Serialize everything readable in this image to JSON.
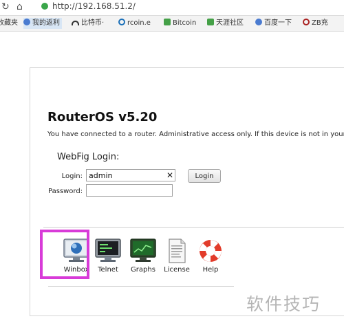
{
  "browser": {
    "url": "http://192.168.51.2/",
    "bookmarks": [
      {
        "label": "收藏夹",
        "icon": "folder-icon",
        "color": "#c9a13b"
      },
      {
        "label": "我的返利",
        "icon": "paw-icon",
        "color": "#4a7bd0"
      },
      {
        "label": "比特币·",
        "icon": "arc-icon",
        "color": "#333333"
      },
      {
        "label": "rcoin.e",
        "icon": "ring-icon",
        "color": "#1a6fb8"
      },
      {
        "label": "Bitcoin",
        "icon": "leaf-icon",
        "color": "#44a047"
      },
      {
        "label": "天涯社区",
        "icon": "leaf-icon",
        "color": "#44a047"
      },
      {
        "label": "百度一下",
        "icon": "paw-icon",
        "color": "#4a7bd0"
      },
      {
        "label": "ZB充",
        "icon": "ring-icon",
        "color": "#aa2222"
      }
    ]
  },
  "page": {
    "title": "RouterOS v5.20",
    "notice": "You have connected to a router. Administrative access only. If this device is not in your possession",
    "login_heading": "WebFig Login:",
    "login_label": "Login:",
    "login_value": "admin",
    "password_label": "Password:",
    "login_button": "Login",
    "clear_glyph": "✕"
  },
  "tools": [
    {
      "label": "Winbox",
      "icon": "winbox-monitor-icon"
    },
    {
      "label": "Telnet",
      "icon": "terminal-monitor-icon"
    },
    {
      "label": "Graphs",
      "icon": "graphs-monitor-icon"
    },
    {
      "label": "License",
      "icon": "license-document-icon"
    },
    {
      "label": "Help",
      "icon": "lifebuoy-icon"
    }
  ],
  "highlight_color": "#d83bd8",
  "watermark": "软件技巧"
}
